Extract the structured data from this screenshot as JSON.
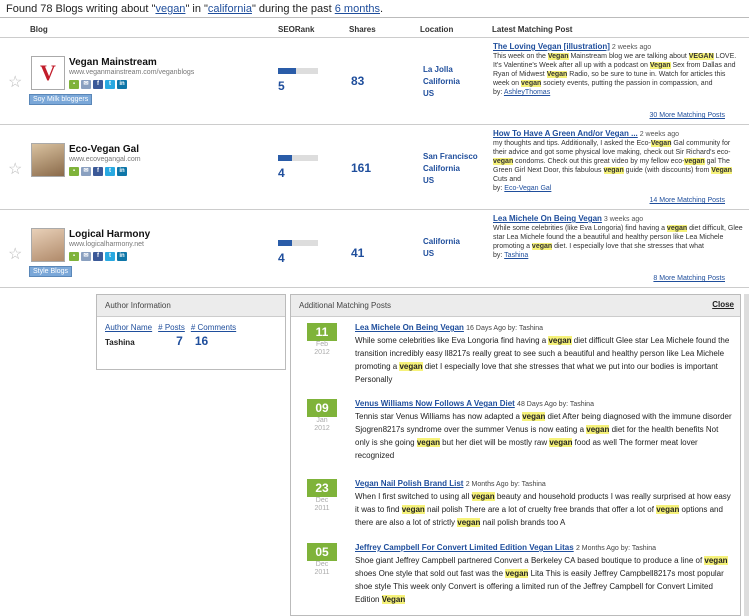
{
  "header": {
    "found": "Found 78 Blogs writing about \"",
    "keyword": "vegan",
    "mid": "\" in \"",
    "location": "california",
    "mid2": "\" during the past ",
    "period": "6 months",
    "end": "."
  },
  "columns": {
    "blog": "Blog",
    "seorank": "SEORank",
    "shares": "Shares",
    "location": "Location",
    "post": "Latest Matching Post"
  },
  "blogs": [
    {
      "name": "Vegan Mainstream",
      "url": "www.veganmainstream.com/veganblogs",
      "tag": "Soy Milk bloggers",
      "seorank": "5",
      "seo_fraction": 0.45,
      "shares": "83",
      "city": "La Jolla",
      "state": "California",
      "country": "US",
      "post_title": "The Loving Vegan [illustration]",
      "post_ago": "2 weeks ago",
      "post_parts": [
        "This week on the ",
        "Vegan",
        " Mainstream blog we are talking about ",
        "VEGAN",
        " LOVE. It's Valentine's Week after all up with a podcast on ",
        "Vegan",
        " Sex from Dallas and Ryan of Midwest ",
        "Vegan",
        " Radio, so be sure to tune in. Watch for articles this week on ",
        "vegan",
        " society events, putting the passion in compassion, and"
      ],
      "by_label": "by:",
      "author": "AshleyThomas",
      "more": "30 More Matching Posts"
    },
    {
      "name": "Eco-Vegan Gal",
      "url": "www.ecovegangal.com",
      "tag": "",
      "seorank": "4",
      "seo_fraction": 0.35,
      "shares": "161",
      "city": "San Francisco",
      "state": "California",
      "country": "US",
      "post_title": "How To Have A Green And/or Vegan ...",
      "post_ago": "2 weeks ago",
      "post_parts": [
        "my thoughts and tips. Additionally, I asked the Eco-",
        "Vegan",
        " Gal community for their advice and got some physical love making, check out Sir Richard's eco-",
        "vegan",
        " condoms. Check out this great video by my fellow eco-",
        "vegan",
        " gal The Green Girl Next Door, this fabulous ",
        "vegan",
        " guide (with discounts) from ",
        "Vegan",
        " Cuts and"
      ],
      "by_label": "by:",
      "author": "Eco-Vegan Gal",
      "more": "14 More Matching Posts"
    },
    {
      "name": "Logical Harmony",
      "url": "www.logicalharmony.net",
      "tag": "Style Blogs",
      "seorank": "4",
      "seo_fraction": 0.35,
      "shares": "41",
      "city": "",
      "state": "California",
      "country": "US",
      "post_title": "Lea Michele On Being Vegan",
      "post_ago": "3 weeks ago",
      "post_parts": [
        "While some celebrities (like Eva Longoria) find having a ",
        "vegan",
        " diet difficult, Glee star Lea Michele found the a beautiful and healthy person like Lea Michele promoting a ",
        "vegan",
        " diet. I especially love that she stresses that what"
      ],
      "by_label": "by:",
      "author": "Tashina",
      "more": "8 More Matching Posts"
    }
  ],
  "author_info": {
    "title": "Author Information",
    "col_name": "Author Name",
    "col_posts": "# Posts",
    "col_comments": "# Comments",
    "name": "Tashina",
    "posts": "7",
    "comments": "16"
  },
  "additional": {
    "title": "Additional Matching Posts",
    "close": "Close",
    "posts": [
      {
        "day": "11",
        "month": "Feb",
        "year": "2012",
        "title": "Lea Michele On Being Vegan",
        "ago": "16 Days Ago by: Tashina",
        "parts": [
          "While some celebrities like Eva Longoria find having a ",
          "vegan",
          " diet difficult Glee star Lea Michele found the transition incredibly easy ll8217s really great to see such a beautiful and healthy person like Lea Michele promoting a ",
          "vegan",
          " diet I especially love that she stresses that what we put into our bodies is important Personally"
        ]
      },
      {
        "day": "09",
        "month": "Jan",
        "year": "2012",
        "title": "Venus Williams Now Follows A Vegan Diet",
        "ago": "48 Days Ago by: Tashina",
        "parts": [
          "Tennis star Venus Williams has now adapted a ",
          "vegan",
          " diet After being diagnosed with the immune disorder Sjogren8217s syndrome over the summer Venus is now eating a ",
          "vegan",
          " diet for the health benefits Not only is she going ",
          "vegan",
          " but her diet will be mostly raw ",
          "vegan",
          " food as well The former meat lover recognized"
        ]
      },
      {
        "day": "23",
        "month": "Dec",
        "year": "2011",
        "title": "Vegan Nail Polish Brand List",
        "ago": "2 Months Ago by: Tashina",
        "parts": [
          "When I first switched to using all ",
          "vegan",
          " beauty and household products I was really surprised at how easy it was to find ",
          "vegan",
          " nail polish There are a lot of cruelty free brands that offer a lot of ",
          "vegan",
          " options and there are also a lot of strictly ",
          "vegan",
          " nail polish brands too A"
        ]
      },
      {
        "day": "05",
        "month": "Dec",
        "year": "2011",
        "title": "Jeffrey Campbell For Convert Limited Edition Vegan Litas",
        "ago": "2 Months Ago by: Tashina",
        "parts": [
          "Shoe giant Jeffrey Campbell partnered Convert a Berkeley CA based boutique to produce a line of ",
          "vegan",
          " shoes One style that sold out fast was the ",
          "vegan",
          " Lita This is easily Jeffrey Campbell8217s most popular shoe style This week only Convert is offering a limited run of the Jeffrey Campbell for Convert Limited Edition ",
          "Vegan"
        ]
      }
    ]
  },
  "colors": {
    "link": "#1f4e9c",
    "highlight": "#f6f27a",
    "date_green": "#7fb33a",
    "tag_blue": "#7aa7d8"
  }
}
